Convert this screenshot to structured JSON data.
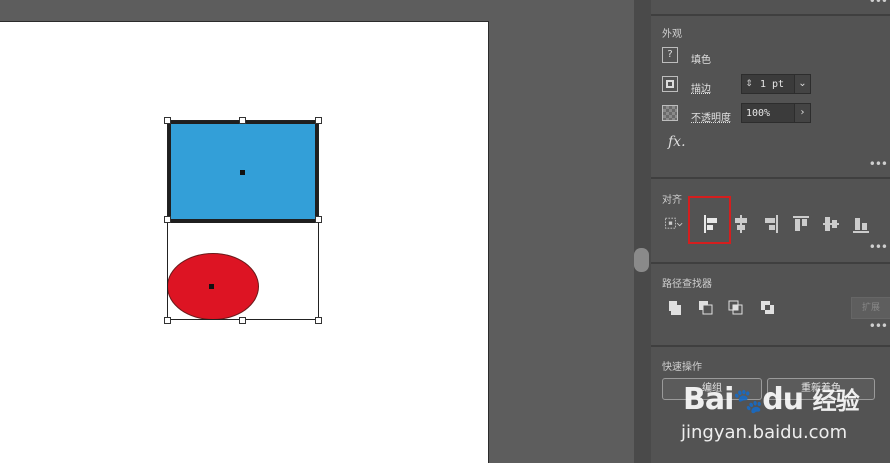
{
  "appearance": {
    "title": "外观",
    "fill_icon_glyph": "?",
    "fill_label": "填色",
    "stroke_label": "描边",
    "stroke_value": "1 pt",
    "opacity_label": "不透明度",
    "opacity_value": "100%",
    "fx_label": "fx."
  },
  "align": {
    "title": "对齐"
  },
  "pathfinder": {
    "title": "路径查找器",
    "expand_label": "扩展"
  },
  "quick_actions": {
    "title": "快速操作",
    "group_label": "编组",
    "recolor_label": "重新着色"
  },
  "watermark": {
    "brand": "Bai",
    "brand_tail": "du",
    "suffix": "经验",
    "url": "jingyan.baidu.com"
  },
  "colors": {
    "rect_fill": "#339fd8",
    "ellipse_fill": "#dd1423",
    "highlight": "#d41e1e",
    "panel_bg": "#535353"
  },
  "icons": [
    "help-icon",
    "stroke-icon",
    "transparency-icon",
    "fx-icon",
    "align-to-icon",
    "align-left-icon",
    "align-hcenter-icon",
    "align-right-icon",
    "align-top-icon",
    "align-vcenter-icon",
    "align-bottom-icon",
    "unite-icon",
    "minus-front-icon",
    "intersect-icon",
    "exclude-icon",
    "more-options-icon"
  ]
}
